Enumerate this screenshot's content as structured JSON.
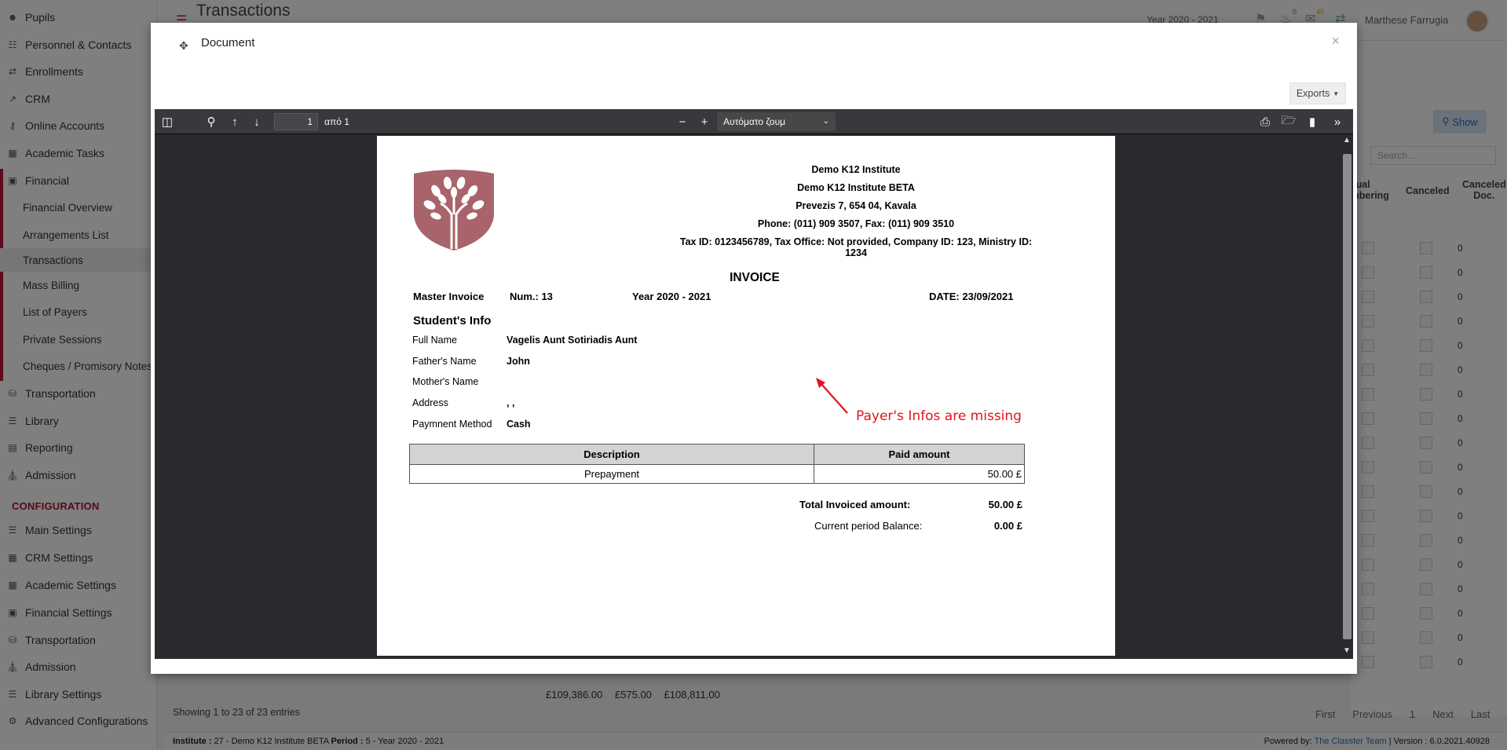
{
  "sidebar": {
    "items": [
      {
        "label": "Pupils",
        "icon": "users-icon"
      },
      {
        "label": "Personnel & Contacts",
        "icon": "contacts-icon"
      },
      {
        "label": "Enrollments",
        "icon": "transfer-icon"
      },
      {
        "label": "CRM",
        "icon": "chart-icon"
      },
      {
        "label": "Online Accounts",
        "icon": "key-icon"
      },
      {
        "label": "Academic Tasks",
        "icon": "grid-icon"
      },
      {
        "label": "Financial",
        "icon": "coins-icon"
      },
      {
        "label": "Financial Overview"
      },
      {
        "label": "Arrangements List"
      },
      {
        "label": "Transactions"
      },
      {
        "label": "Mass Billing"
      },
      {
        "label": "List of Payers"
      },
      {
        "label": "Private Sessions"
      },
      {
        "label": "Cheques / Promisory Notes"
      },
      {
        "label": "Transportation",
        "icon": "bus-icon"
      },
      {
        "label": "Library",
        "icon": "library-icon"
      },
      {
        "label": "Reporting",
        "icon": "report-icon"
      },
      {
        "label": "Admission",
        "icon": "building-icon"
      }
    ],
    "config_header": "CONFIGURATION",
    "config_items": [
      {
        "label": "Main Settings"
      },
      {
        "label": "CRM Settings"
      },
      {
        "label": "Academic Settings"
      },
      {
        "label": "Financial Settings"
      },
      {
        "label": "Transportation"
      },
      {
        "label": "Admission"
      },
      {
        "label": "Library Settings"
      },
      {
        "label": "Advanced Configurations"
      }
    ]
  },
  "header": {
    "title": "Transactions",
    "year": "Year 2020 - 2021",
    "user": "Marthese Farrugia",
    "badges": [
      "0",
      "45"
    ]
  },
  "background_table": {
    "show_label": "Show",
    "search_placeholder": "Search...",
    "col_numbering": "anual\numbering",
    "col_canceled": "Canceled",
    "col_canceled_doc": "Canceled\nDoc.",
    "zero": "0",
    "sums": [
      "£109,386.00",
      "£575.00",
      "£108,811.00"
    ],
    "entries": "Showing 1 to 23 of 23 entries",
    "pager": [
      "First",
      "Previous",
      "1",
      "Next",
      "Last"
    ]
  },
  "statusbar": {
    "institute_label": "Institute :",
    "institute_value": "27 - Demo K12 Institute BETA",
    "period_label": "Period :",
    "period_value": "5 - Year 2020 - 2021",
    "powered": "Powered by:",
    "brand": "The Classter Team",
    "version": "| Version : 6.0.2021.40928"
  },
  "modal": {
    "title": "Document",
    "exports_label": "Exports"
  },
  "viewer": {
    "page_value": "1",
    "page_of": "από 1",
    "zoom": "Αυτόματο ζουμ"
  },
  "document": {
    "inst_lines": [
      "Demo K12 Institute",
      "Demo K12 Institute BETA",
      "Prevezis 7, 654 04, Kavala",
      "Phone: (011) 909 3507, Fax: (011) 909 3510"
    ],
    "tax_line": "Tax ID: 0123456789, Tax Office: Not provided, Company ID: 123, Ministry ID: 1234",
    "title": "INVOICE",
    "invoice_type": "Master Invoice",
    "num": "Num.: 13",
    "year": "Year 2020 - 2021",
    "date": "DATE: 23/09/2021",
    "section_title": "Student's Info",
    "info": [
      {
        "label": "Full Name",
        "value": "Vagelis Aunt Sotiriadis Aunt"
      },
      {
        "label": "Father's Name",
        "value": "John"
      },
      {
        "label": "Mother's Name",
        "value": ""
      },
      {
        "label": "Address",
        "value": ", ,"
      },
      {
        "label": "Paymnent Method",
        "value": "Cash"
      }
    ],
    "table": {
      "headers": [
        "Description",
        "Paid amount"
      ],
      "rows": [
        [
          "Prepayment",
          "50.00 £"
        ]
      ]
    },
    "total_label": "Total Invoiced amount:",
    "total_value": "50.00 £",
    "balance_label": "Current period Balance:",
    "balance_value": "0.00 £"
  },
  "annotation": "Payer's Infos are missing",
  "colors": {
    "accent": "#c3143b",
    "logo": "#a8636b",
    "annotation": "#e0141e"
  }
}
